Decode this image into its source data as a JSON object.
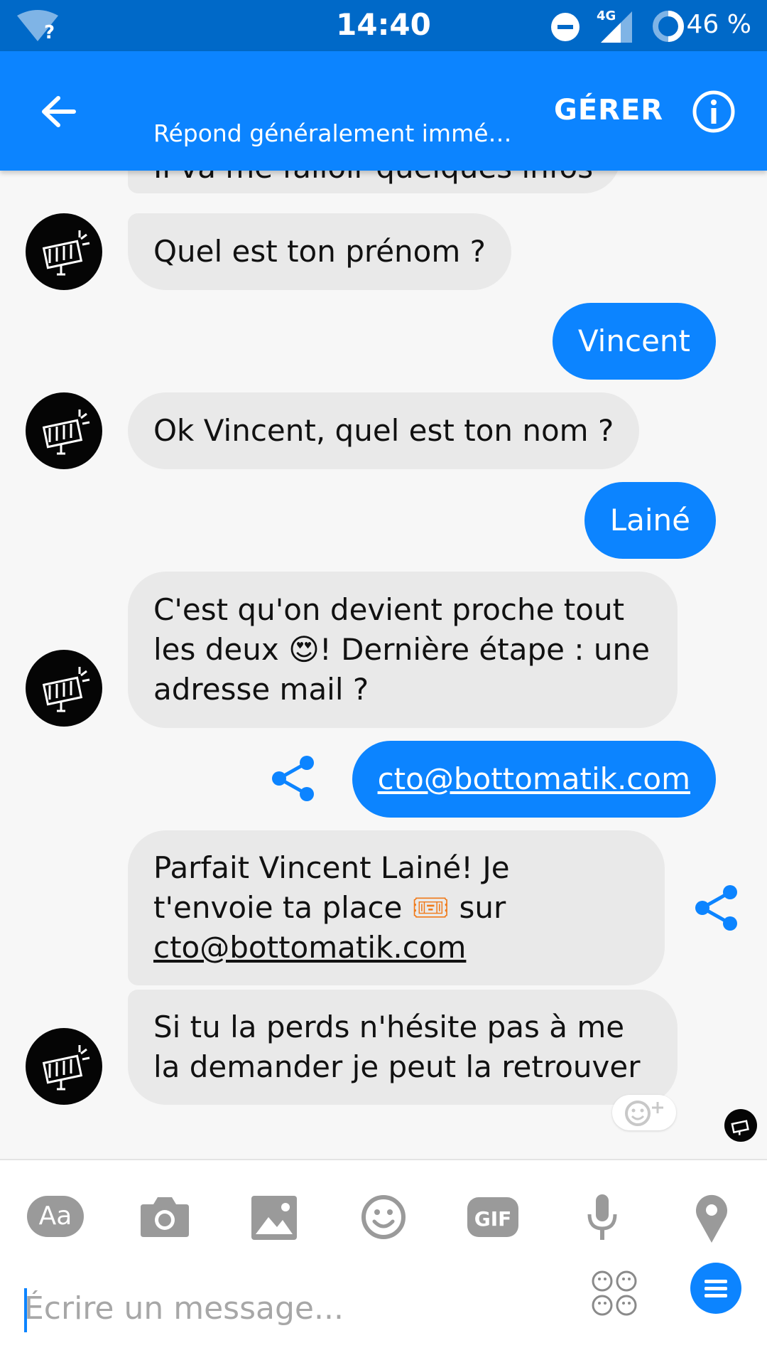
{
  "status_bar": {
    "time": "14:40",
    "network_label": "4G",
    "battery_text": "46 %",
    "wifi_unknown": "?"
  },
  "header": {
    "subtitle": "Répond généralement immé…",
    "manage_label": "GÉRER",
    "icons": [
      "back-arrow-icon",
      "info-icon"
    ]
  },
  "messages": [
    {
      "sender": "bot",
      "text": "Il va me falloir quelques infos"
    },
    {
      "sender": "bot",
      "text": "Quel est ton prénom ?"
    },
    {
      "sender": "user",
      "text": "Vincent"
    },
    {
      "sender": "bot",
      "text": "Ok Vincent, quel est ton nom ?"
    },
    {
      "sender": "user",
      "text": "Lainé"
    },
    {
      "sender": "bot",
      "line1": "C'est qu'on devient proche tout",
      "line2_pre": "les deux ",
      "emoji": "😍",
      "line2_post": "! Dernière étape : une",
      "line3": "adresse mail ?"
    },
    {
      "sender": "user",
      "text": "cto@bottomatik.com"
    },
    {
      "sender": "bot",
      "line1": "Parfait Vincent Lainé! Je",
      "line2_pre": "t'envoie ta place ",
      "emoji": "🎟",
      "line2_post": " sur",
      "line3": "cto@bottomatik.com"
    },
    {
      "sender": "bot",
      "line1": "Si tu la perds n'hésite pas à me",
      "line2": "la demander je peut la retrouver"
    }
  ],
  "composer": {
    "placeholder": "Écrire un message...",
    "aa_label": "Aa",
    "gif_label": "GIF",
    "tools": [
      "text-format-icon",
      "camera-icon",
      "image-icon",
      "emoji-icon",
      "gif-icon",
      "microphone-icon",
      "location-icon"
    ]
  },
  "colors": {
    "status_bar": "#0069c8",
    "accent": "#0c84ff",
    "bot_bubble": "#e9e9e9",
    "background": "#f7f7f7",
    "tool_gray": "#9a9a9a"
  }
}
